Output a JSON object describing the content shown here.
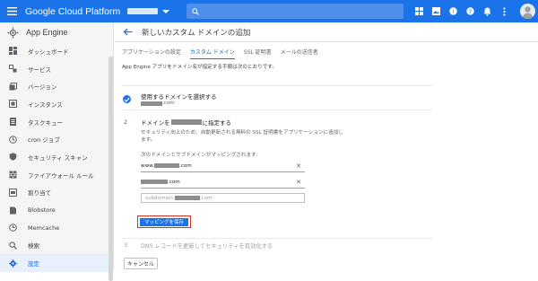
{
  "header": {
    "brand": "Google Cloud Platform",
    "search_placeholder": "",
    "icons": [
      "apps-icon",
      "image-icon",
      "help-outline-icon",
      "help-icon",
      "bell-icon",
      "more-vert-icon"
    ]
  },
  "sidebar": {
    "title": "App Engine",
    "items": [
      {
        "label": "ダッシュボード",
        "icon": "dashboard-icon"
      },
      {
        "label": "サービス",
        "icon": "services-icon"
      },
      {
        "label": "バージョン",
        "icon": "versions-icon"
      },
      {
        "label": "インスタンス",
        "icon": "instances-icon"
      },
      {
        "label": "タスクキュー",
        "icon": "task-queue-icon"
      },
      {
        "label": "cron ジョブ",
        "icon": "clock-icon"
      },
      {
        "label": "セキュリティ スキャン",
        "icon": "shield-icon"
      },
      {
        "label": "ファイアウォール ルール",
        "icon": "firewall-icon"
      },
      {
        "label": "割り当て",
        "icon": "quota-icon"
      },
      {
        "label": "Blobstore",
        "icon": "blobstore-icon"
      },
      {
        "label": "Memcache",
        "icon": "memcache-icon"
      },
      {
        "label": "検索",
        "icon": "search-icon"
      },
      {
        "label": "設定",
        "icon": "settings-icon"
      }
    ]
  },
  "main": {
    "title": "新しいカスタム ドメインの追加",
    "tabs": [
      "アプリケーションの設定",
      "カスタム ドメイン",
      "SSL 証明書",
      "メールの送信者"
    ],
    "active_tab": 1,
    "intro": "App Engine アプリをドメイン名が指定する手順は次のとおりです。",
    "step1": {
      "title": "使用するドメインを選択する",
      "domain_suffix": ".com"
    },
    "step2": {
      "number": "2",
      "title_prefix": "ドメインを",
      "title_suffix": "に指定する",
      "description": "セキュリティ向上のため、自動更新される無料の SSL 証明書をアプリケーションに追加します。",
      "mapping_label": "次のドメインとサブドメインがマッピングされます:",
      "domains": [
        {
          "prefix": "www.",
          "suffix": ".com"
        },
        {
          "prefix": "",
          "suffix": ".com"
        }
      ],
      "input_prefix": "subdomain.",
      "input_suffix": ".com",
      "save_label": "マッピングを保存"
    },
    "step3": {
      "number": "3",
      "title": "DNS レコードを更新してセキュリティを有効化する"
    },
    "cancel_label": "キャンセル"
  }
}
